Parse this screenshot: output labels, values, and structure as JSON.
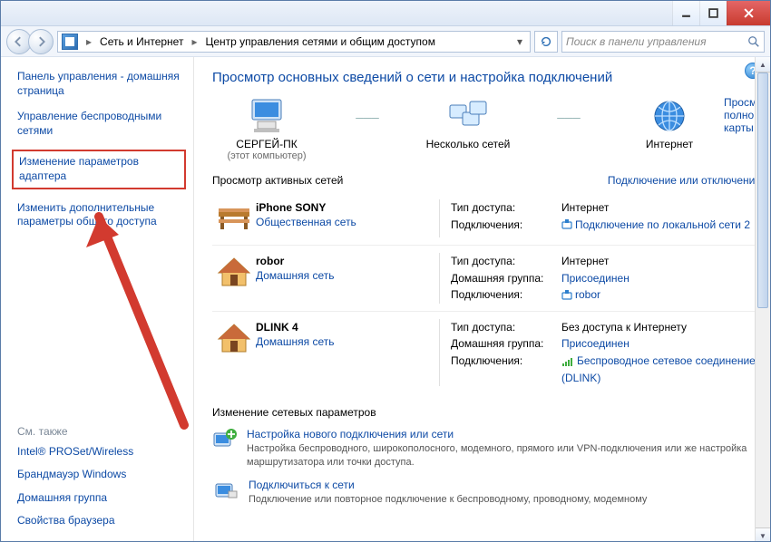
{
  "breadcrumb": {
    "part1": "Сеть и Интернет",
    "part2": "Центр управления сетями и общим доступом"
  },
  "search": {
    "placeholder": "Поиск в панели управления"
  },
  "sidebar": {
    "items": [
      {
        "label": "Панель управления - домашняя страница"
      },
      {
        "label": "Управление беспроводными сетями"
      },
      {
        "label": "Изменение параметров адаптера"
      },
      {
        "label": "Изменить дополнительные параметры общего доступа"
      }
    ],
    "see_also_title": "См. также",
    "see_also": [
      {
        "label": "Intel® PROSet/Wireless"
      },
      {
        "label": "Брандмауэр Windows"
      },
      {
        "label": "Домашняя группа"
      },
      {
        "label": "Свойства браузера"
      }
    ]
  },
  "main": {
    "title": "Просмотр основных сведений о сети и настройка подключений",
    "map_link": "Просмотр полной карты",
    "top_nodes": {
      "pc": {
        "label": "СЕРГЕЙ-ПК",
        "sub": "(этот компьютер)"
      },
      "mid": {
        "label": "Несколько сетей"
      },
      "net": {
        "label": "Интернет"
      }
    },
    "active_title": "Просмотр активных сетей",
    "active_link": "Подключение или отключение",
    "networks": [
      {
        "name": "iPhone SONY",
        "type": "Общественная сеть",
        "icon": "bench",
        "props": [
          {
            "k": "Тип доступа:",
            "v": "Интернет",
            "link": false
          },
          {
            "k": "Подключения:",
            "v": "Подключение по локальной сети 2",
            "link": true,
            "sig": "eth"
          }
        ]
      },
      {
        "name": "robor",
        "type": "Домашняя сеть",
        "icon": "house",
        "props": [
          {
            "k": "Тип доступа:",
            "v": "Интернет",
            "link": false
          },
          {
            "k": "Домашняя группа:",
            "v": "Присоединен",
            "link": true
          },
          {
            "k": "Подключения:",
            "v": "robor",
            "link": true,
            "sig": "eth"
          }
        ]
      },
      {
        "name": "DLINK  4",
        "type": "Домашняя сеть",
        "icon": "house",
        "props": [
          {
            "k": "Тип доступа:",
            "v": "Без доступа к Интернету",
            "link": false
          },
          {
            "k": "Домашняя группа:",
            "v": "Присоединен",
            "link": true
          },
          {
            "k": "Подключения:",
            "v": "Беспроводное сетевое соединение (DLINK)",
            "link": true,
            "sig": "wifi"
          }
        ]
      }
    ],
    "change_hdr": "Изменение сетевых параметров",
    "tasks": [
      {
        "title": "Настройка нового подключения или сети",
        "desc": "Настройка беспроводного, широкополосного, модемного, прямого или VPN-подключения или же настройка маршрутизатора или точки доступа."
      },
      {
        "title": "Подключиться к сети",
        "desc": "Подключение или повторное подключение к беспроводному, проводному, модемному"
      }
    ]
  }
}
